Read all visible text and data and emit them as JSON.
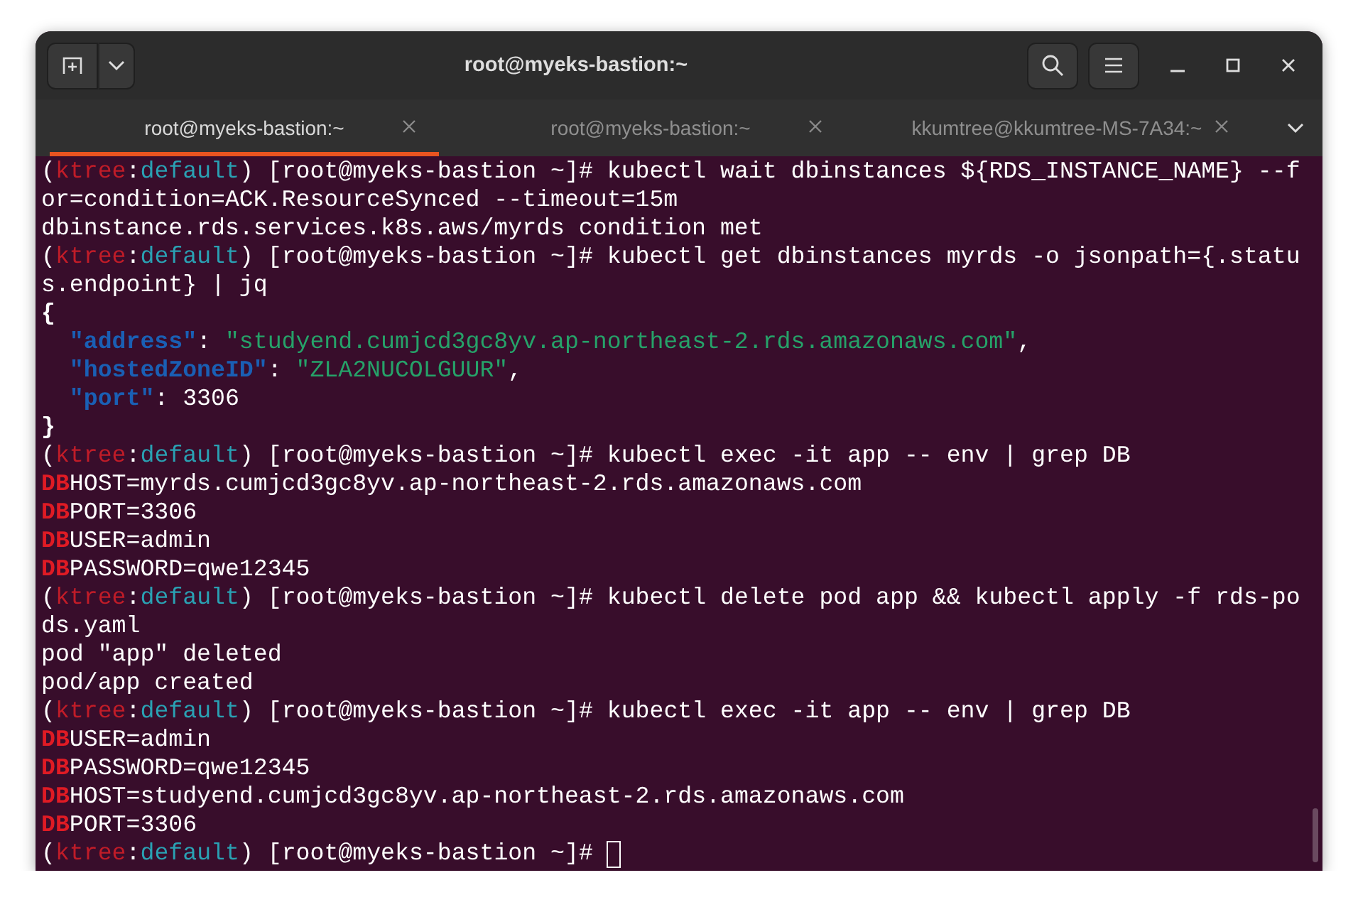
{
  "window": {
    "title": "root@myeks-bastion:~"
  },
  "tabs": [
    {
      "label": "root@myeks-bastion:~",
      "selected": true
    },
    {
      "label": "root@myeks-bastion:~",
      "selected": false
    },
    {
      "label": "kkumtree@kkumtree-MS-7A34:~",
      "selected": false
    }
  ],
  "terminal": {
    "lines": [
      {
        "segments": [
          {
            "kind": "plain",
            "text": "("
          },
          {
            "kind": "red",
            "text": "ktree"
          },
          {
            "kind": "plain",
            "text": ":"
          },
          {
            "kind": "teal",
            "text": "default"
          },
          {
            "kind": "plain",
            "text": ") [root@myeks-bastion ~]# kubectl wait dbinstances ${RDS_INSTANCE_NAME} --f"
          }
        ]
      },
      {
        "segments": [
          {
            "kind": "plain",
            "text": "or=condition=ACK.ResourceSynced --timeout=15m"
          }
        ]
      },
      {
        "segments": [
          {
            "kind": "plain",
            "text": "dbinstance.rds.services.k8s.aws/myrds condition met"
          }
        ]
      },
      {
        "segments": [
          {
            "kind": "plain",
            "text": "("
          },
          {
            "kind": "red",
            "text": "ktree"
          },
          {
            "kind": "plain",
            "text": ":"
          },
          {
            "kind": "teal",
            "text": "default"
          },
          {
            "kind": "plain",
            "text": ") [root@myeks-bastion ~]# kubectl get dbinstances myrds -o jsonpath={.statu"
          }
        ]
      },
      {
        "segments": [
          {
            "kind": "plain",
            "text": "s.endpoint} | jq"
          }
        ]
      },
      {
        "segments": [
          {
            "kind": "bold",
            "text": "{"
          }
        ]
      },
      {
        "indented": true,
        "segments": [
          {
            "kind": "key",
            "text": "\"address\""
          },
          {
            "kind": "plain",
            "text": ": "
          },
          {
            "kind": "string",
            "text": "\"studyend.cumjcd3gc8yv.ap-northeast-2.rds.amazonaws.com\""
          },
          {
            "kind": "plain",
            "text": ","
          }
        ]
      },
      {
        "indented": true,
        "segments": [
          {
            "kind": "key",
            "text": "\"hostedZoneID\""
          },
          {
            "kind": "plain",
            "text": ": "
          },
          {
            "kind": "string",
            "text": "\"ZLA2NUCOLGUUR\""
          },
          {
            "kind": "plain",
            "text": ","
          }
        ]
      },
      {
        "indented": true,
        "segments": [
          {
            "kind": "key",
            "text": "\"port\""
          },
          {
            "kind": "plain",
            "text": ": 3306"
          }
        ]
      },
      {
        "segments": [
          {
            "kind": "bold",
            "text": "}"
          }
        ]
      },
      {
        "segments": [
          {
            "kind": "plain",
            "text": "("
          },
          {
            "kind": "red",
            "text": "ktree"
          },
          {
            "kind": "plain",
            "text": ":"
          },
          {
            "kind": "teal",
            "text": "default"
          },
          {
            "kind": "plain",
            "text": ") [root@myeks-bastion ~]# kubectl exec -it app -- env | grep DB"
          }
        ]
      },
      {
        "segments": [
          {
            "kind": "match",
            "text": "DB"
          },
          {
            "kind": "plain",
            "text": "HOST=myrds.cumjcd3gc8yv.ap-northeast-2.rds.amazonaws.com"
          }
        ]
      },
      {
        "segments": [
          {
            "kind": "match",
            "text": "DB"
          },
          {
            "kind": "plain",
            "text": "PORT=3306"
          }
        ]
      },
      {
        "segments": [
          {
            "kind": "match",
            "text": "DB"
          },
          {
            "kind": "plain",
            "text": "USER=admin"
          }
        ]
      },
      {
        "segments": [
          {
            "kind": "match",
            "text": "DB"
          },
          {
            "kind": "plain",
            "text": "PASSWORD=qwe12345"
          }
        ]
      },
      {
        "segments": [
          {
            "kind": "plain",
            "text": "("
          },
          {
            "kind": "red",
            "text": "ktree"
          },
          {
            "kind": "plain",
            "text": ":"
          },
          {
            "kind": "teal",
            "text": "default"
          },
          {
            "kind": "plain",
            "text": ") [root@myeks-bastion ~]# kubectl delete pod app && kubectl apply -f rds-po"
          }
        ]
      },
      {
        "segments": [
          {
            "kind": "plain",
            "text": "ds.yaml"
          }
        ]
      },
      {
        "segments": [
          {
            "kind": "plain",
            "text": "pod \"app\" deleted"
          }
        ]
      },
      {
        "segments": [
          {
            "kind": "plain",
            "text": "pod/app created"
          }
        ]
      },
      {
        "segments": [
          {
            "kind": "plain",
            "text": "("
          },
          {
            "kind": "red",
            "text": "ktree"
          },
          {
            "kind": "plain",
            "text": ":"
          },
          {
            "kind": "teal",
            "text": "default"
          },
          {
            "kind": "plain",
            "text": ") [root@myeks-bastion ~]# kubectl exec -it app -- env | grep DB"
          }
        ]
      },
      {
        "segments": [
          {
            "kind": "match",
            "text": "DB"
          },
          {
            "kind": "plain",
            "text": "USER=admin"
          }
        ]
      },
      {
        "segments": [
          {
            "kind": "match",
            "text": "DB"
          },
          {
            "kind": "plain",
            "text": "PASSWORD=qwe12345"
          }
        ]
      },
      {
        "segments": [
          {
            "kind": "match",
            "text": "DB"
          },
          {
            "kind": "plain",
            "text": "HOST=studyend.cumjcd3gc8yv.ap-northeast-2.rds.amazonaws.com"
          }
        ]
      },
      {
        "segments": [
          {
            "kind": "match",
            "text": "DB"
          },
          {
            "kind": "plain",
            "text": "PORT=3306"
          }
        ]
      },
      {
        "segments": [
          {
            "kind": "plain",
            "text": "("
          },
          {
            "kind": "red",
            "text": "ktree"
          },
          {
            "kind": "plain",
            "text": ":"
          },
          {
            "kind": "teal",
            "text": "default"
          },
          {
            "kind": "plain",
            "text": ") [root@myeks-bastion ~]# "
          }
        ],
        "cursor": true
      }
    ]
  }
}
